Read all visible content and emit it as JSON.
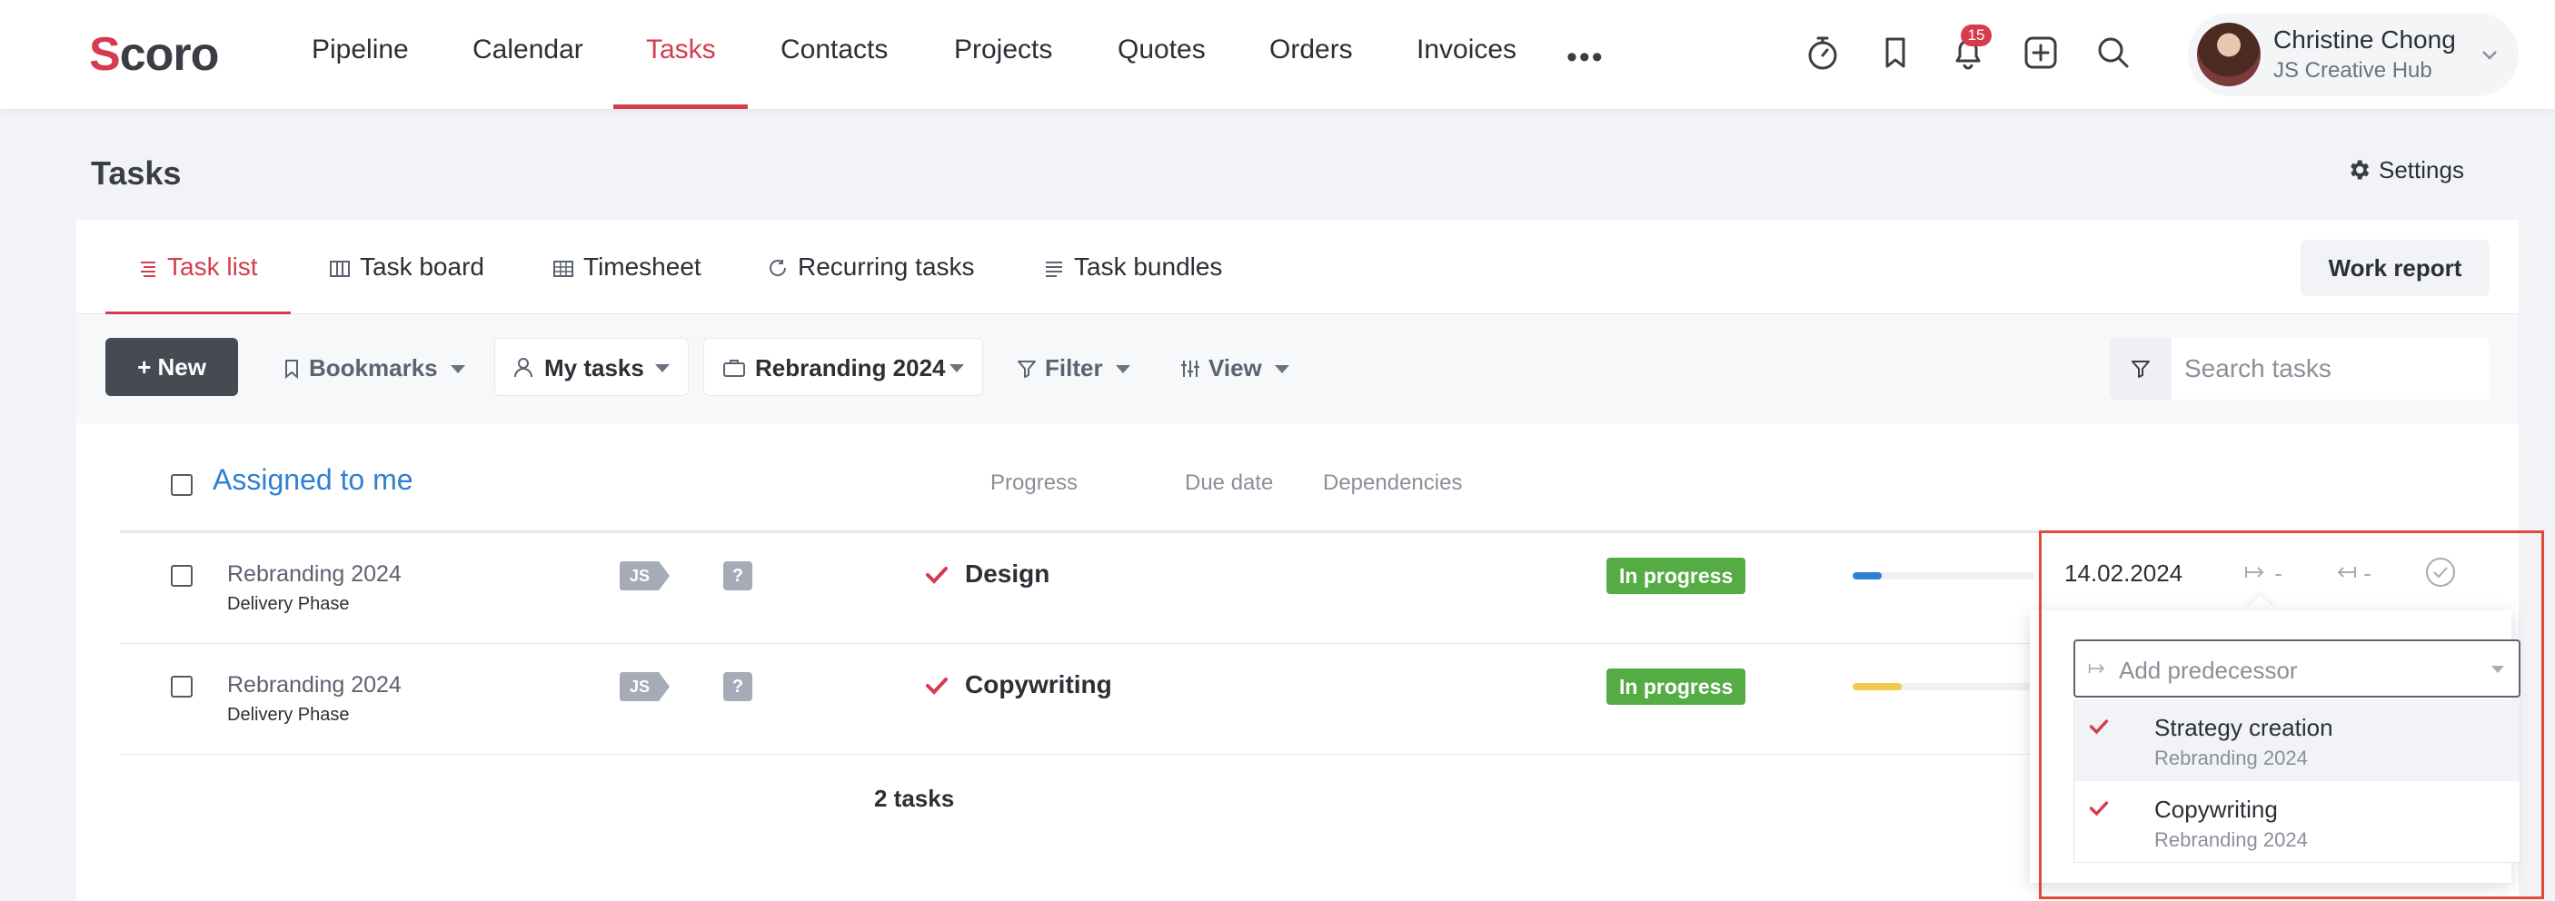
{
  "brand": {
    "logo_text": "Scoro",
    "accent": "#d63b4e"
  },
  "nav": {
    "items": [
      {
        "label": "Pipeline"
      },
      {
        "label": "Calendar"
      },
      {
        "label": "Tasks",
        "active": true
      },
      {
        "label": "Contacts"
      },
      {
        "label": "Projects"
      },
      {
        "label": "Quotes"
      },
      {
        "label": "Orders"
      },
      {
        "label": "Invoices"
      }
    ],
    "more_label": "•••",
    "notification_count": "15",
    "icons": [
      "stopwatch-icon",
      "bookmark-icon",
      "bell-icon",
      "add-square-icon",
      "search-icon"
    ]
  },
  "user": {
    "name": "Christine Chong",
    "company": "JS Creative Hub"
  },
  "page": {
    "title": "Tasks",
    "settings_label": "Settings"
  },
  "tabs": [
    {
      "label": "Task list",
      "icon": "list-icon",
      "active": true
    },
    {
      "label": "Task board",
      "icon": "board-icon"
    },
    {
      "label": "Timesheet",
      "icon": "grid-icon"
    },
    {
      "label": "Recurring tasks",
      "icon": "refresh-icon"
    },
    {
      "label": "Task bundles",
      "icon": "lines-icon"
    }
  ],
  "work_report_label": "Work report",
  "toolbar": {
    "new_label": "+ New",
    "bookmarks_label": "Bookmarks",
    "my_tasks_label": "My tasks",
    "project_label": "Rebranding 2024",
    "filter_label": "Filter",
    "view_label": "View",
    "search_placeholder": "Search tasks"
  },
  "table": {
    "group_title": "Assigned to me",
    "columns": {
      "progress": "Progress",
      "due_date": "Due date",
      "dependencies": "Dependencies"
    },
    "rows": [
      {
        "project": "Rebranding 2024",
        "phase": "Delivery Phase",
        "assignee": "JS",
        "unknown": "?",
        "task": "Design",
        "status": "In progress",
        "progress": 0.16,
        "progress_color": "#2f80d1",
        "due": "14.02.2024",
        "pred": "-",
        "succ": "-"
      },
      {
        "project": "Rebranding 2024",
        "phase": "Delivery Phase",
        "assignee": "JS",
        "unknown": "?",
        "task": "Copywriting",
        "status": "In progress",
        "progress": 0.27,
        "progress_color": "#f2c94c",
        "due": "",
        "pred": "",
        "succ": ""
      }
    ],
    "count_label": "2 tasks"
  },
  "dependency_dropdown": {
    "placeholder": "Add predecessor",
    "options": [
      {
        "title": "Strategy creation",
        "project": "Rebranding 2024",
        "highlighted": true
      },
      {
        "title": "Copywriting",
        "project": "Rebranding 2024"
      }
    ]
  }
}
